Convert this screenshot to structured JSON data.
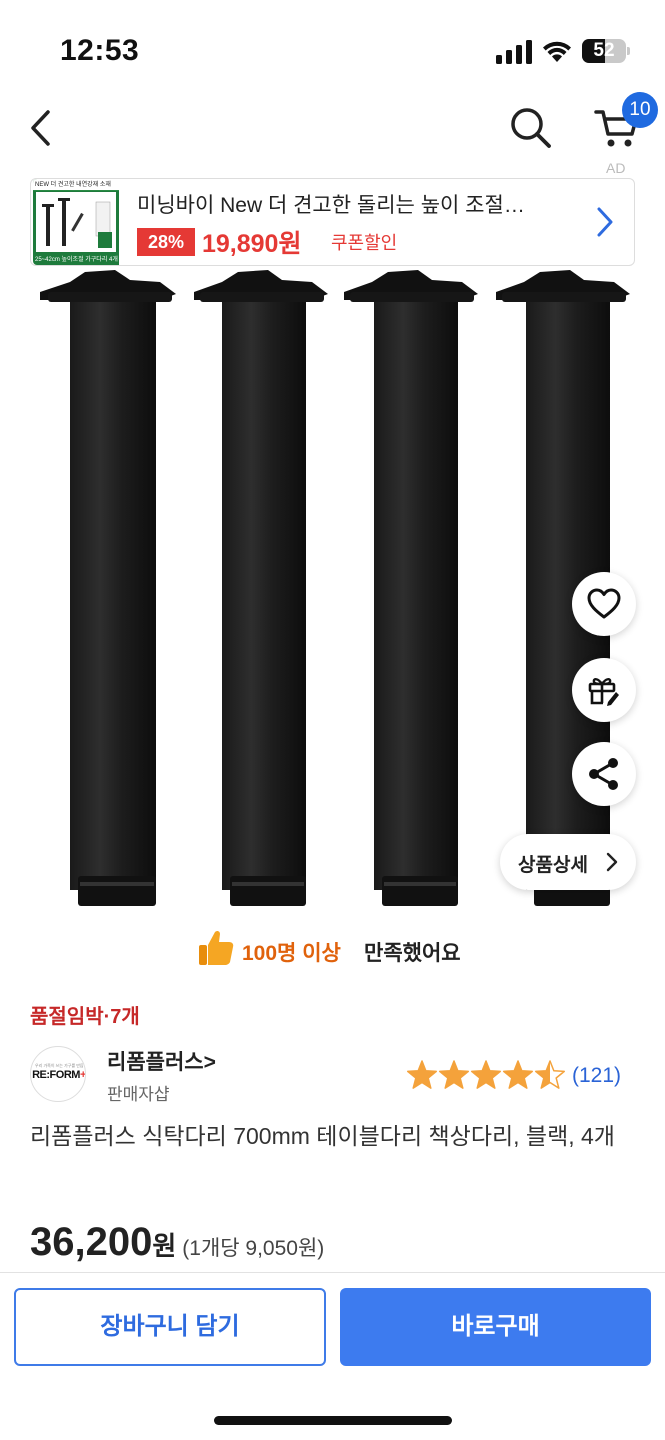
{
  "status_bar": {
    "time": "12:53",
    "battery_level": "52",
    "battery_fraction": 0.52
  },
  "nav": {
    "back_icon": "chevron-left-icon",
    "search_icon": "search-icon",
    "cart_icon": "cart-icon",
    "cart_badge": "10",
    "ad_mark": "AD"
  },
  "ad": {
    "title": "미닝바이 New 더 견고한 돌리는 높이 조절…",
    "discount": "28%",
    "price": "19,890원",
    "coupon": "쿠폰할인",
    "thumb_top_text": "NEW 더 견고한 내연강재 소재",
    "thumb_bottom_text": "25~42cm 높이조절 가구다리 4개"
  },
  "floating": {
    "wishlist_icon": "heart-icon",
    "gift_icon": "gift-icon",
    "share_icon": "share-icon",
    "detail_label": "상품상세"
  },
  "satisfaction": {
    "highlight": "100명 이상",
    "rest": "만족했어요"
  },
  "stock_warning": "품절임박·7개",
  "seller": {
    "logo_text": "RE:FORM",
    "name": "리폼플러스",
    "type": "판매자샵",
    "rating": 4.5,
    "rating_max": 5,
    "review_count": "(121)"
  },
  "product": {
    "title": "리폼플러스 식탁다리 700mm 테이블다리 책상다리, 블랙, 4개",
    "price": "36,200",
    "price_unit": "원",
    "unit_price": "(1개당 9,050원)"
  },
  "buttons": {
    "cart": "장바구니 담기",
    "buy": "바로구매"
  },
  "colors": {
    "accent_blue": "#3d7bef",
    "sale_red": "#e53935",
    "highlight_orange": "#e0620c",
    "star": "#f4a23b"
  }
}
